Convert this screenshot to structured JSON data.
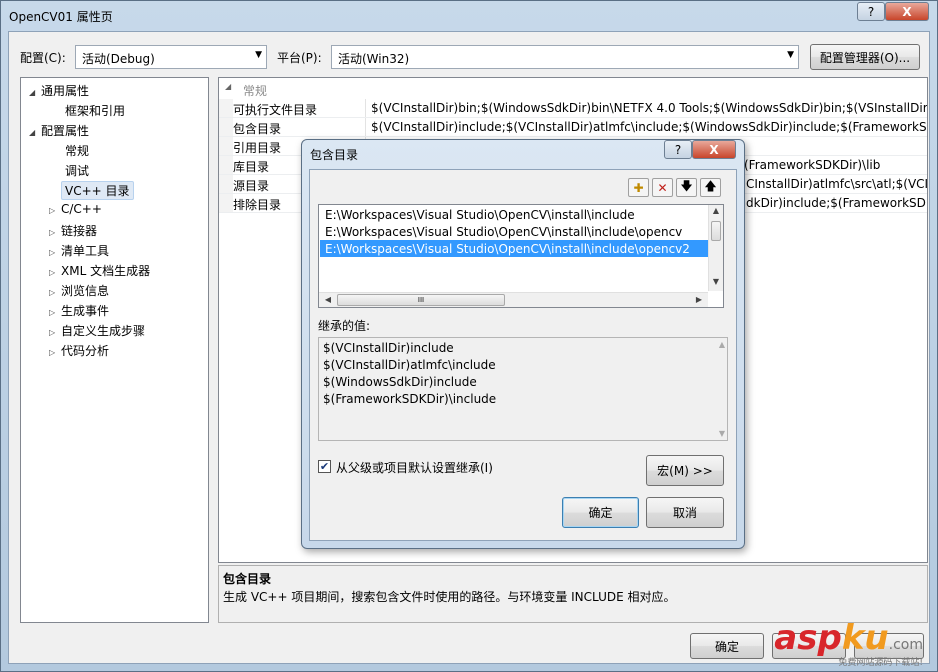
{
  "window": {
    "title": "OpenCV01 属性页",
    "help_label": "?",
    "close_label": "X"
  },
  "toolbar": {
    "config_label": "配置(C):",
    "config_value": "活动(Debug)",
    "platform_label": "平台(P):",
    "platform_value": "活动(Win32)",
    "config_manager_label": "配置管理器(O)..."
  },
  "tree": {
    "items": [
      {
        "label": "通用属性",
        "expander": "◢"
      },
      {
        "label": "框架和引用"
      },
      {
        "label": "配置属性",
        "expander": "◢"
      },
      {
        "label": "常规"
      },
      {
        "label": "调试"
      },
      {
        "label": "VC++ 目录"
      },
      {
        "label": "C/C++",
        "expander": "▷"
      },
      {
        "label": "链接器",
        "expander": "▷"
      },
      {
        "label": "清单工具",
        "expander": "▷"
      },
      {
        "label": "XML 文档生成器",
        "expander": "▷"
      },
      {
        "label": "浏览信息",
        "expander": "▷"
      },
      {
        "label": "生成事件",
        "expander": "▷"
      },
      {
        "label": "自定义生成步骤",
        "expander": "▷"
      },
      {
        "label": "代码分析",
        "expander": "▷"
      }
    ]
  },
  "grid": {
    "category": "常规",
    "rows": [
      {
        "name": "可执行文件目录",
        "value": "$(VCInstallDir)bin;$(WindowsSdkDir)bin\\NETFX 4.0 Tools;$(WindowsSdkDir)bin;$(VSInstallDir)"
      },
      {
        "name": "包含目录",
        "value": "$(VCInstallDir)include;$(VCInstallDir)atlmfc\\include;$(WindowsSdkDir)include;$(FrameworkSDKDir)"
      },
      {
        "name": "引用目录",
        "value": ""
      },
      {
        "name": "库目录",
        "value": "(FrameworkSDKDir)\\lib"
      },
      {
        "name": "源目录",
        "value": "CInstallDir)atlmfc\\src\\atl;$(VCI"
      },
      {
        "name": "排除目录",
        "value": "dkDir)include;$(FrameworkSDK"
      }
    ]
  },
  "description": {
    "title": "包含目录",
    "text": "生成 VC++ 项目期间，搜索包含文件时使用的路径。与环境变量 INCLUDE 相对应。"
  },
  "dialog": {
    "title": "包含目录",
    "help_label": "?",
    "close_label": "X",
    "list_items": [
      "E:\\Workspaces\\Visual Studio\\OpenCV\\install\\include",
      "E:\\Workspaces\\Visual Studio\\OpenCV\\install\\include\\opencv",
      "E:\\Workspaces\\Visual Studio\\OpenCV\\install\\include\\opencv2"
    ],
    "hscroll_grip": "III",
    "inherited_label": "继承的值:",
    "inherited_items": [
      "$(VCInstallDir)include",
      "$(VCInstallDir)atlmfc\\include",
      "$(WindowsSdkDir)include",
      "$(FrameworkSDKDir)\\include"
    ],
    "inherit_checkbox_label": "从父级或项目默认设置继承(I)",
    "inherit_checked": true,
    "macro_label": "宏(M) >>",
    "ok_label": "确定",
    "cancel_label": "取消"
  },
  "footer": {
    "ok_label": "确定"
  },
  "watermark": {
    "brand_asp": "asp",
    "brand_ku": "ku",
    "brand_com": ".com",
    "tagline": "免费网站源码下载站!"
  },
  "colors": {
    "selection": "#3399ff",
    "watermark_red": "#d8262b",
    "watermark_orange": "#f19a1f"
  }
}
